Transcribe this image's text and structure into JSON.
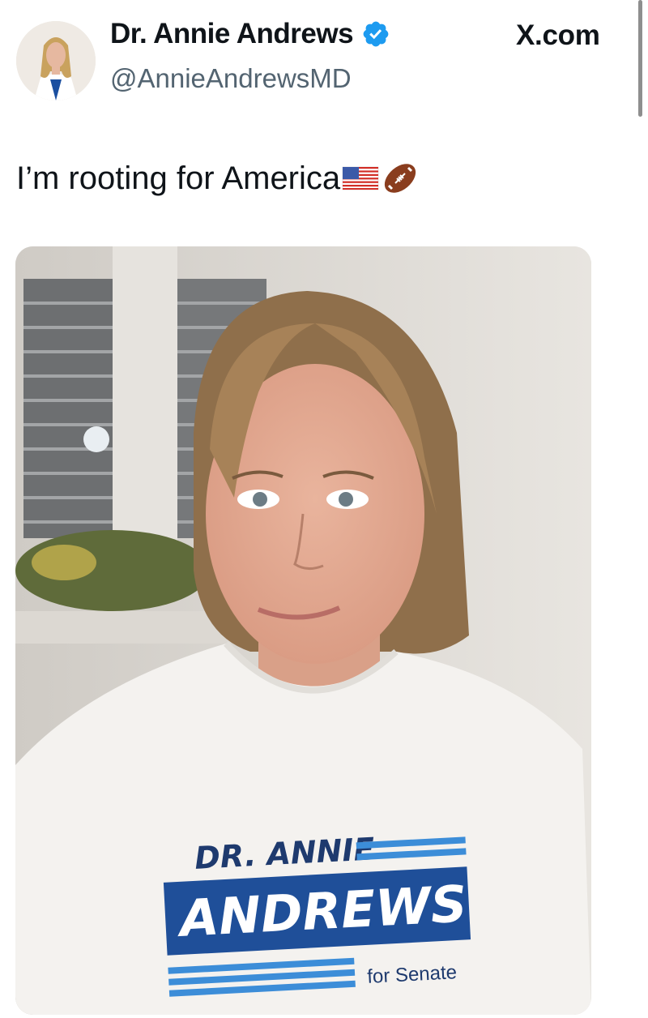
{
  "header": {
    "display_name": "Dr. Annie Andrews",
    "handle": "@AnnieAndrewsMD",
    "site": "X.com",
    "verified": true,
    "verified_color": "#1d9bf0"
  },
  "tweet": {
    "text": "I’m rooting for America",
    "emojis": [
      "us-flag-emoji",
      "american-football-emoji"
    ]
  },
  "photo": {
    "shirt": {
      "line1": "DR. ANNIE",
      "line2": "ANDREWS",
      "line3": "for Senate"
    },
    "shirt_blue": "#2b6cb0"
  }
}
